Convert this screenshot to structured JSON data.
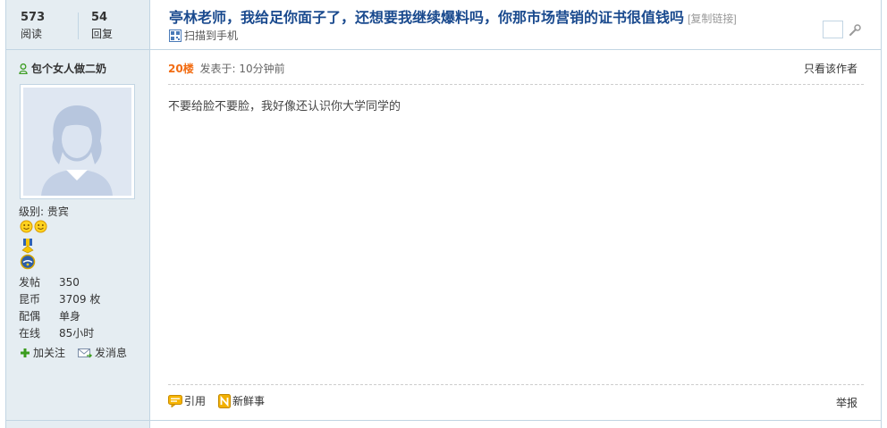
{
  "thread": {
    "views": "573",
    "views_label": "阅读",
    "replies": "54",
    "replies_label": "回复",
    "title": "亭林老师，我给足你面子了，还想要我继续爆料吗，你那市场营销的证书很值钱吗",
    "copy_link": "[复制链接]",
    "qr_label": "扫描到手机"
  },
  "author": {
    "name": "包个女人做二奶",
    "level": "级别: 贵宾",
    "stats": [
      {
        "key": "发帖",
        "value": "350"
      },
      {
        "key": "昆币",
        "value": "3709 枚"
      },
      {
        "key": "配偶",
        "value": "单身"
      },
      {
        "key": "在线",
        "value": "85小时"
      }
    ],
    "follow_label": "加关注",
    "message_label": "发消息"
  },
  "post": {
    "floor": "20楼",
    "posted": "发表于: 10分钟前",
    "only_author": "只看该作者",
    "content": "不要给脸不要脸，我好像还认识你大学同学的",
    "quote_label": "引用",
    "news_label": "新鲜事",
    "report_label": "举报"
  },
  "colors": {
    "title": "#1a4a8e",
    "floor": "#f26c12",
    "side_bg": "#e5edf2",
    "border": "#c2d5e3"
  }
}
